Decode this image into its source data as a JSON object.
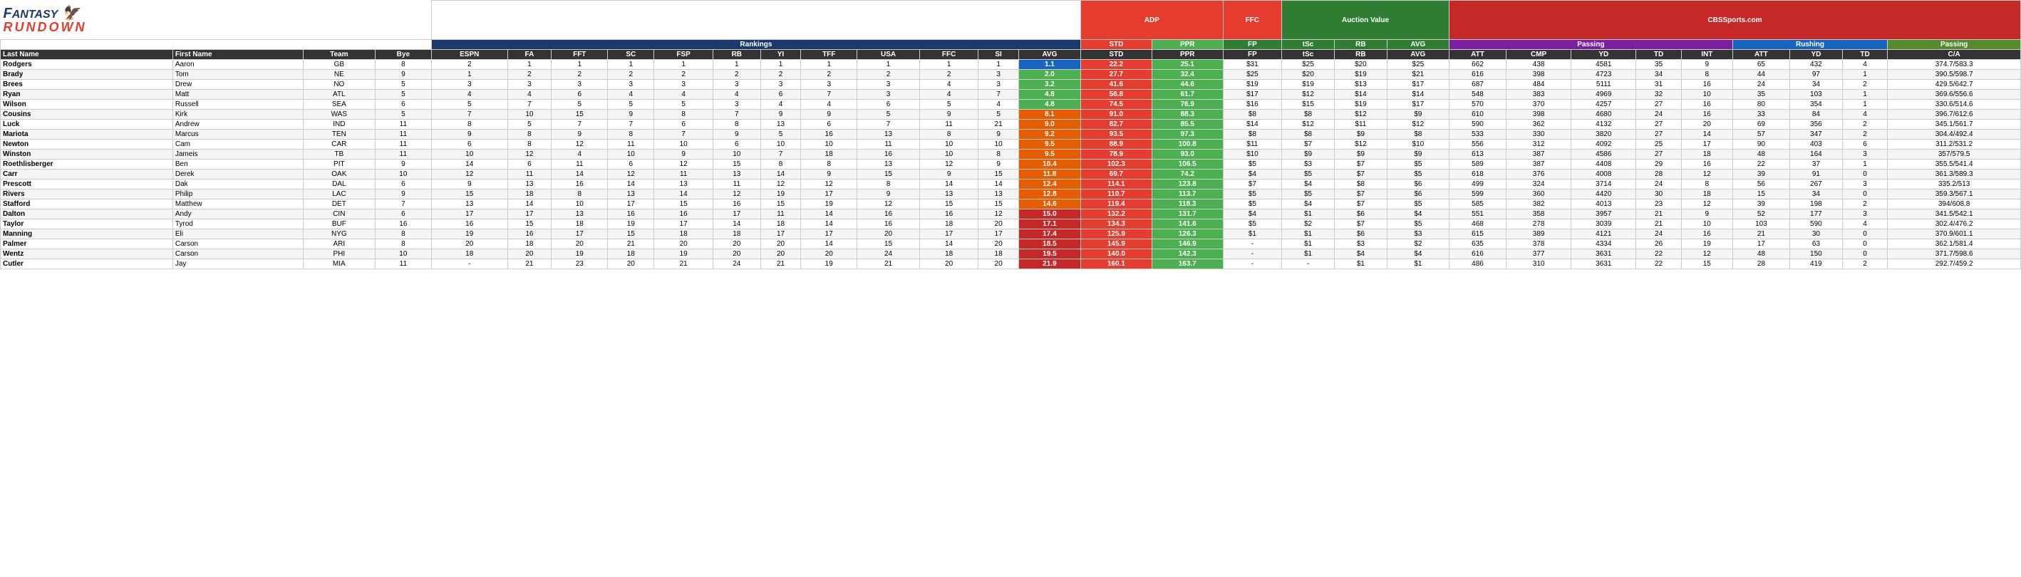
{
  "logo": {
    "fantasy": "FANTASY",
    "rundown": "RUNDOWN"
  },
  "groups": {
    "adp": "ADP",
    "ffc": "FFC",
    "rankings": "Rankings",
    "auction": "Auction Value",
    "cbs": "CBSSports.com",
    "passing": "Passing",
    "rushing": "Rushing",
    "passing2": "Passing"
  },
  "col_headers": {
    "last": "Last Name",
    "first": "First Name",
    "team": "Team",
    "bye": "Bye",
    "espn": "ESPN",
    "fa": "FA",
    "fft": "FFT",
    "sc": "SC",
    "fsp": "FSP",
    "rb": "RB",
    "yi": "YI",
    "tff": "TFF",
    "usa": "USA",
    "ffc": "FFC",
    "si": "SI",
    "avg": "AVG",
    "std": "STD",
    "ppr": "PPR",
    "fp": "FP",
    "tsc": "tSc",
    "rb2": "RB",
    "avg2": "AVG",
    "att": "ATT",
    "cmp": "CMP",
    "yd": "YD",
    "td": "TD",
    "int": "INT",
    "att2": "ATT",
    "yd2": "YD",
    "td2": "TD",
    "ca": "C/A"
  },
  "players": [
    {
      "last": "Rodgers",
      "first": "Aaron",
      "team": "GB",
      "bye": 8,
      "espn": 2,
      "fa": 1,
      "fft": 1,
      "sc": 1,
      "fsp": 1,
      "rb": 1,
      "yi": 1,
      "tff": 1,
      "usa": 1,
      "ffc": 1,
      "si": 1,
      "avg": "1.1",
      "avg_class": "avg-blue",
      "std": "22.2",
      "ppr": "25.1",
      "fp": "$31",
      "tsc": "$25",
      "rb3": "$20",
      "avg3": "$25",
      "att": 662,
      "cmp": 438,
      "yd": 4581,
      "td": 35,
      "int": 9,
      "att2": 65,
      "yd2": 432,
      "td2": 4,
      "ca": "374.7/583.3"
    },
    {
      "last": "Brady",
      "first": "Tom",
      "team": "NE",
      "bye": 9,
      "espn": 1,
      "fa": 2,
      "fft": 2,
      "sc": 2,
      "fsp": 2,
      "rb": 2,
      "yi": 2,
      "tff": 2,
      "usa": 2,
      "ffc": 2,
      "si": 3,
      "avg": "2.0",
      "avg_class": "avg-green",
      "std": "27.7",
      "ppr": "32.4",
      "fp": "$25",
      "tsc": "$20",
      "rb3": "$19",
      "avg3": "$21",
      "att": 616,
      "cmp": 398,
      "yd": 4723,
      "td": 34,
      "int": 8,
      "att2": 44,
      "yd2": 97,
      "td2": 1,
      "ca": "390.5/598.7"
    },
    {
      "last": "Brees",
      "first": "Drew",
      "team": "NO",
      "bye": 5,
      "espn": 3,
      "fa": 3,
      "fft": 3,
      "sc": 3,
      "fsp": 3,
      "rb": 3,
      "yi": 3,
      "tff": 3,
      "usa": 3,
      "ffc": 4,
      "si": 3,
      "avg": "3.2",
      "avg_class": "avg-green",
      "std": "41.6",
      "ppr": "44.6",
      "fp": "$19",
      "tsc": "$19",
      "rb3": "$13",
      "avg3": "$17",
      "att": 687,
      "cmp": 484,
      "yd": 5111,
      "td": 31,
      "int": 16,
      "att2": 24,
      "yd2": 34,
      "td2": 2,
      "ca": "429.5/642.7"
    },
    {
      "last": "Ryan",
      "first": "Matt",
      "team": "ATL",
      "bye": 5,
      "espn": 4,
      "fa": 4,
      "fft": 6,
      "sc": 4,
      "fsp": 4,
      "rb": 4,
      "yi": 6,
      "tff": 7,
      "usa": 3,
      "ffc": 4,
      "si": 7,
      "avg": "4.8",
      "avg_class": "avg-green",
      "std": "56.8",
      "ppr": "61.7",
      "fp": "$17",
      "tsc": "$12",
      "rb3": "$14",
      "avg3": "$14",
      "att": 548,
      "cmp": 383,
      "yd": 4969,
      "td": 32,
      "int": 10,
      "att2": 35,
      "yd2": 103,
      "td2": 1,
      "ca": "369.6/556.6"
    },
    {
      "last": "Wilson",
      "first": "Russell",
      "team": "SEA",
      "bye": 6,
      "espn": 5,
      "fa": 7,
      "fft": 5,
      "sc": 5,
      "fsp": 5,
      "rb": 3,
      "yi": 4,
      "tff": 4,
      "usa": 6,
      "ffc": 5,
      "si": 4,
      "avg": "4.8",
      "avg_class": "avg-green",
      "std": "74.5",
      "ppr": "76.9",
      "fp": "$16",
      "tsc": "$15",
      "rb3": "$19",
      "avg3": "$17",
      "att": 570,
      "cmp": 370,
      "yd": 4257,
      "td": 27,
      "int": 16,
      "att2": 80,
      "yd2": 354,
      "td2": 1,
      "ca": "330.6/514.6"
    },
    {
      "last": "Cousins",
      "first": "Kirk",
      "team": "WAS",
      "bye": 5,
      "espn": 7,
      "fa": 10,
      "fft": 15,
      "sc": 9,
      "fsp": 8,
      "rb": 7,
      "yi": 9,
      "tff": 9,
      "usa": 5,
      "ffc": 9,
      "si": 5,
      "avg": "8.1",
      "avg_class": "avg-yellow",
      "std": "91.0",
      "ppr": "88.3",
      "fp": "$8",
      "tsc": "$8",
      "rb3": "$12",
      "avg3": "$9",
      "att": 610,
      "cmp": 398,
      "yd": 4680,
      "td": 24,
      "int": 16,
      "att2": 33,
      "yd2": 84,
      "td2": 4,
      "ca": "396.7/612.6"
    },
    {
      "last": "Luck",
      "first": "Andrew",
      "team": "IND",
      "bye": 11,
      "espn": 8,
      "fa": 5,
      "fft": 7,
      "sc": 7,
      "fsp": 6,
      "rb": 8,
      "yi": 13,
      "tff": 6,
      "usa": 7,
      "ffc": 11,
      "si": 21,
      "avg": "9.0",
      "avg_class": "avg-yellow",
      "std": "82.7",
      "ppr": "85.5",
      "fp": "$14",
      "tsc": "$12",
      "rb3": "$11",
      "avg3": "$12",
      "att": 590,
      "cmp": 362,
      "yd": 4132,
      "td": 27,
      "int": 20,
      "att2": 69,
      "yd2": 356,
      "td2": 2,
      "ca": "345.1/561.7"
    },
    {
      "last": "Mariota",
      "first": "Marcus",
      "team": "TEN",
      "bye": 11,
      "espn": 9,
      "fa": 8,
      "fft": 9,
      "sc": 8,
      "fsp": 7,
      "rb": 9,
      "yi": 5,
      "tff": 16,
      "usa": 13,
      "ffc": 8,
      "si": 9,
      "avg": "9.2",
      "avg_class": "avg-yellow",
      "std": "93.5",
      "ppr": "97.3",
      "fp": "$8",
      "tsc": "$8",
      "rb3": "$9",
      "avg3": "$8",
      "att": 533,
      "cmp": 330,
      "yd": 3820,
      "td": 27,
      "int": 14,
      "att2": 57,
      "yd2": 347,
      "td2": 2,
      "ca": "304.4/492.4"
    },
    {
      "last": "Newton",
      "first": "Cam",
      "team": "CAR",
      "bye": 11,
      "espn": 6,
      "fa": 8,
      "fft": 12,
      "sc": 11,
      "fsp": 10,
      "rb": 6,
      "yi": 10,
      "tff": 10,
      "usa": 11,
      "ffc": 10,
      "si": 10,
      "avg": "9.5",
      "avg_class": "avg-yellow",
      "std": "88.9",
      "ppr": "100.8",
      "fp": "$11",
      "tsc": "$7",
      "rb3": "$12",
      "avg3": "$10",
      "att": 556,
      "cmp": 312,
      "yd": 4092,
      "td": 25,
      "int": 17,
      "att2": 90,
      "yd2": 403,
      "td2": 6,
      "ca": "311.2/531.2"
    },
    {
      "last": "Winston",
      "first": "Jameis",
      "team": "TB",
      "bye": 11,
      "espn": 10,
      "fa": 12,
      "fft": 4,
      "sc": 10,
      "fsp": 9,
      "rb": 10,
      "yi": 7,
      "tff": 18,
      "usa": 16,
      "ffc": 10,
      "si": 8,
      "avg": "9.5",
      "avg_class": "avg-yellow",
      "std": "78.9",
      "ppr": "93.0",
      "fp": "$10",
      "tsc": "$9",
      "rb3": "$9",
      "avg3": "$9",
      "att": 613,
      "cmp": 387,
      "yd": 4586,
      "td": 27,
      "int": 18,
      "att2": 48,
      "yd2": 164,
      "td2": 3,
      "ca": "357/579.5"
    },
    {
      "last": "Roethlisberger",
      "first": "Ben",
      "team": "PIT",
      "bye": 9,
      "espn": 14,
      "fa": 6,
      "fft": 11,
      "sc": 6,
      "fsp": 12,
      "rb": 15,
      "yi": 8,
      "tff": 8,
      "usa": 13,
      "ffc": 12,
      "si": 9,
      "avg": "10.4",
      "avg_class": "avg-yellow",
      "std": "102.3",
      "ppr": "106.5",
      "fp": "$5",
      "tsc": "$3",
      "rb3": "$7",
      "avg3": "$5",
      "att": 589,
      "cmp": 387,
      "yd": 4408,
      "td": 29,
      "int": 16,
      "att2": 22,
      "yd2": 37,
      "td2": 1,
      "ca": "355.5/541.4"
    },
    {
      "last": "Carr",
      "first": "Derek",
      "team": "OAK",
      "bye": 10,
      "espn": 12,
      "fa": 11,
      "fft": 14,
      "sc": 12,
      "fsp": 11,
      "rb": 13,
      "yi": 14,
      "tff": 9,
      "usa": 15,
      "ffc": 9,
      "si": 15,
      "avg": "11.8",
      "avg_class": "avg-yellow",
      "std": "69.7",
      "ppr": "74.2",
      "fp": "$4",
      "tsc": "$5",
      "rb3": "$7",
      "avg3": "$5",
      "att": 618,
      "cmp": 376,
      "yd": 4008,
      "td": 28,
      "int": 12,
      "att2": 39,
      "yd2": 91,
      "td2": 0,
      "ca": "361.3/589.3"
    },
    {
      "last": "Prescott",
      "first": "Dak",
      "team": "DAL",
      "bye": 6,
      "espn": 9,
      "fa": 13,
      "fft": 16,
      "sc": 14,
      "fsp": 13,
      "rb": 11,
      "yi": 12,
      "tff": 12,
      "usa": 8,
      "ffc": 14,
      "si": 14,
      "avg": "12.4",
      "avg_class": "avg-yellow",
      "std": "114.1",
      "ppr": "123.8",
      "fp": "$7",
      "tsc": "$4",
      "rb3": "$8",
      "avg3": "$6",
      "att": 499,
      "cmp": 324,
      "yd": 3714,
      "td": 24,
      "int": 8,
      "att2": 56,
      "yd2": 267,
      "td2": 3,
      "ca": "335.2/513"
    },
    {
      "last": "Rivers",
      "first": "Philip",
      "team": "LAC",
      "bye": 9,
      "espn": 15,
      "fa": 18,
      "fft": 8,
      "sc": 13,
      "fsp": 14,
      "rb": 12,
      "yi": 19,
      "tff": 17,
      "usa": 9,
      "ffc": 13,
      "si": 13,
      "avg": "12.8",
      "avg_class": "avg-yellow",
      "std": "110.7",
      "ppr": "113.7",
      "fp": "$5",
      "tsc": "$5",
      "rb3": "$7",
      "avg3": "$6",
      "att": 599,
      "cmp": 360,
      "yd": 4420,
      "td": 30,
      "int": 18,
      "att2": 15,
      "yd2": 34,
      "td2": 0,
      "ca": "359.3/567.1"
    },
    {
      "last": "Stafford",
      "first": "Matthew",
      "team": "DET",
      "bye": 7,
      "espn": 13,
      "fa": 14,
      "fft": 10,
      "sc": 17,
      "fsp": 15,
      "rb": 16,
      "yi": 15,
      "tff": 19,
      "usa": 12,
      "ffc": 15,
      "si": 15,
      "avg": "14.6",
      "avg_class": "avg-yellow",
      "std": "119.4",
      "ppr": "118.3",
      "fp": "$5",
      "tsc": "$4",
      "rb3": "$7",
      "avg3": "$5",
      "att": 585,
      "cmp": 382,
      "yd": 4013,
      "td": 23,
      "int": 12,
      "att2": 39,
      "yd2": 198,
      "td2": 2,
      "ca": "394/608.8"
    },
    {
      "last": "Dalton",
      "first": "Andy",
      "team": "CIN",
      "bye": 6,
      "espn": 17,
      "fa": 17,
      "fft": 13,
      "sc": 16,
      "fsp": 16,
      "rb": 17,
      "yi": 11,
      "tff": 14,
      "usa": 16,
      "ffc": 16,
      "si": 12,
      "avg": "15.0",
      "avg_class": "avg-red",
      "std": "132.2",
      "ppr": "131.7",
      "fp": "$4",
      "tsc": "$1",
      "rb3": "$6",
      "avg3": "$4",
      "att": 551,
      "cmp": 358,
      "yd": 3957,
      "td": 21,
      "int": 9,
      "att2": 52,
      "yd2": 177,
      "td2": 3,
      "ca": "341.5/542.1"
    },
    {
      "last": "Taylor",
      "first": "Tyrod",
      "team": "BUF",
      "bye": 16,
      "espn": 16,
      "fa": 15,
      "fft": 18,
      "sc": 19,
      "fsp": 17,
      "rb": 14,
      "yi": 18,
      "tff": 14,
      "usa": 16,
      "ffc": 18,
      "si": 20,
      "avg": "17.1",
      "avg_class": "avg-red",
      "std": "134.3",
      "ppr": "141.6",
      "fp": "$5",
      "tsc": "$2",
      "rb3": "$7",
      "avg3": "$5",
      "att": 468,
      "cmp": 278,
      "yd": 3039,
      "td": 21,
      "int": 10,
      "att2": 103,
      "yd2": 590,
      "td2": 4,
      "ca": "302.4/476.2"
    },
    {
      "last": "Manning",
      "first": "Eli",
      "team": "NYG",
      "bye": 8,
      "espn": 19,
      "fa": 16,
      "fft": 17,
      "sc": 15,
      "fsp": 18,
      "rb": 18,
      "yi": 17,
      "tff": 17,
      "usa": 20,
      "ffc": 17,
      "si": 17,
      "avg": "17.4",
      "avg_class": "avg-red",
      "std": "125.9",
      "ppr": "126.3",
      "fp": "$1",
      "tsc": "$1",
      "rb3": "$6",
      "avg3": "$3",
      "att": 615,
      "cmp": 389,
      "yd": 4121,
      "td": 24,
      "int": 16,
      "att2": 21,
      "yd2": 30,
      "td2": 0,
      "ca": "370.9/601.1"
    },
    {
      "last": "Palmer",
      "first": "Carson",
      "team": "ARI",
      "bye": 8,
      "espn": 20,
      "fa": 18,
      "fft": 20,
      "sc": 21,
      "fsp": 20,
      "rb": 20,
      "yi": 20,
      "tff": 14,
      "usa": 15,
      "ffc": 14,
      "si": 20,
      "avg": "18.5",
      "avg_class": "avg-red",
      "std": "145.9",
      "ppr": "146.9",
      "fp": "-",
      "tsc": "$1",
      "rb3": "$3",
      "avg3": "$2",
      "att": 635,
      "cmp": 378,
      "yd": 4334,
      "td": 26,
      "int": 19,
      "att2": 17,
      "yd2": 63,
      "td2": 0,
      "ca": "362.1/581.4"
    },
    {
      "last": "Wentz",
      "first": "Carson",
      "team": "PHI",
      "bye": 10,
      "espn": 18,
      "fa": 20,
      "fft": 19,
      "sc": 18,
      "fsp": 19,
      "rb": 20,
      "yi": 20,
      "tff": 20,
      "usa": 24,
      "ffc": 18,
      "si": 18,
      "avg": "19.5",
      "avg_class": "avg-red",
      "std": "140.0",
      "ppr": "142.3",
      "fp": "-",
      "tsc": "$1",
      "rb3": "$4",
      "avg3": "$4",
      "att": 616,
      "cmp": 377,
      "yd": 3631,
      "td": 22,
      "int": 12,
      "att2": 48,
      "yd2": 150,
      "td2": 0,
      "ca": "371.7/598.6"
    },
    {
      "last": "Cutler",
      "first": "Jay",
      "team": "MIA",
      "bye": 11,
      "espn": "-",
      "fa": 21,
      "fft": 23,
      "sc": 20,
      "fsp": 21,
      "rb": 24,
      "yi": 21,
      "tff": 19,
      "usa": 21,
      "ffc": 20,
      "si": 20,
      "avg": "21.9",
      "avg_class": "avg-red",
      "std": "160.1",
      "ppr": "163.7",
      "fp": "-",
      "tsc": "-",
      "rb3": "$1",
      "avg3": "$1",
      "att": 486,
      "cmp": 310,
      "yd": 3631,
      "td": 22,
      "int": 15,
      "att2": 28,
      "yd2": 419,
      "td2": 2,
      "ca": "292.7/459.2"
    }
  ]
}
